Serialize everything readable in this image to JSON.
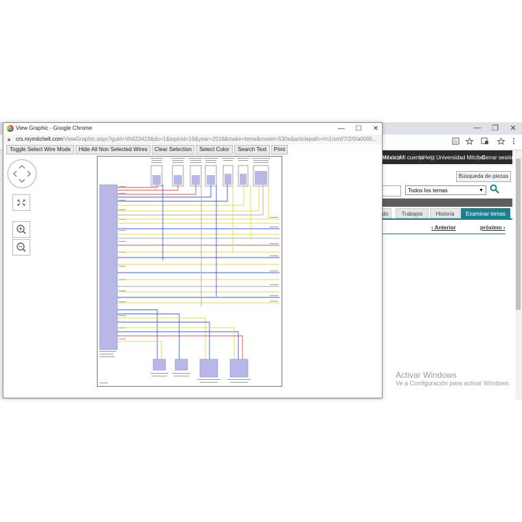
{
  "background_browser": {
    "window_controls": {
      "minimize": "—",
      "restore": "❐",
      "close": "✕"
    },
    "nav": {
      "region": "México",
      "my_account": "Mi cuenta",
      "help": "Help",
      "university": "Universidad Mitchell",
      "logout": "Cerrar sesión"
    },
    "parts_search_label": "Búsqueda de piezas",
    "topics_select_value": "Todos los temas",
    "tabs": [
      {
        "label": "do"
      },
      {
        "label": "Trabajos"
      },
      {
        "label": "Historia"
      },
      {
        "label": "Examinar temas"
      }
    ],
    "prev_link": "‹ Anterior",
    "next_link": "próximo ›"
  },
  "windows_activation": {
    "title": "Activar Windows",
    "subtitle": "Ve a Configuración para activar Windows."
  },
  "popup": {
    "title": "View Graphic - Google Chrome",
    "url_host": "crs.mymitchell.com",
    "url_path": "/ViewGraphic.aspx?guid=VA623423&ds=1&topicid=16&year=2018&make=bmw&model=530e&articlepath=/m1/xml/7/2/0/a0095...",
    "toolbar": {
      "toggle_select": "Toggle Select Wire Mode",
      "hide_non_selected": "Hide All Non Selected Wires",
      "clear_selection": "Clear Selection",
      "select_color": "Select Color",
      "search_text": "Search Text",
      "print": "Print"
    }
  },
  "colors": {
    "tab_active": "#1e7f8f",
    "nav_bg": "#2b2b2b",
    "wire_blue": "#3b5bd0",
    "wire_red": "#d9534f",
    "wire_yellow": "#e8d84a",
    "connector_purple": "#b8b8e8"
  }
}
